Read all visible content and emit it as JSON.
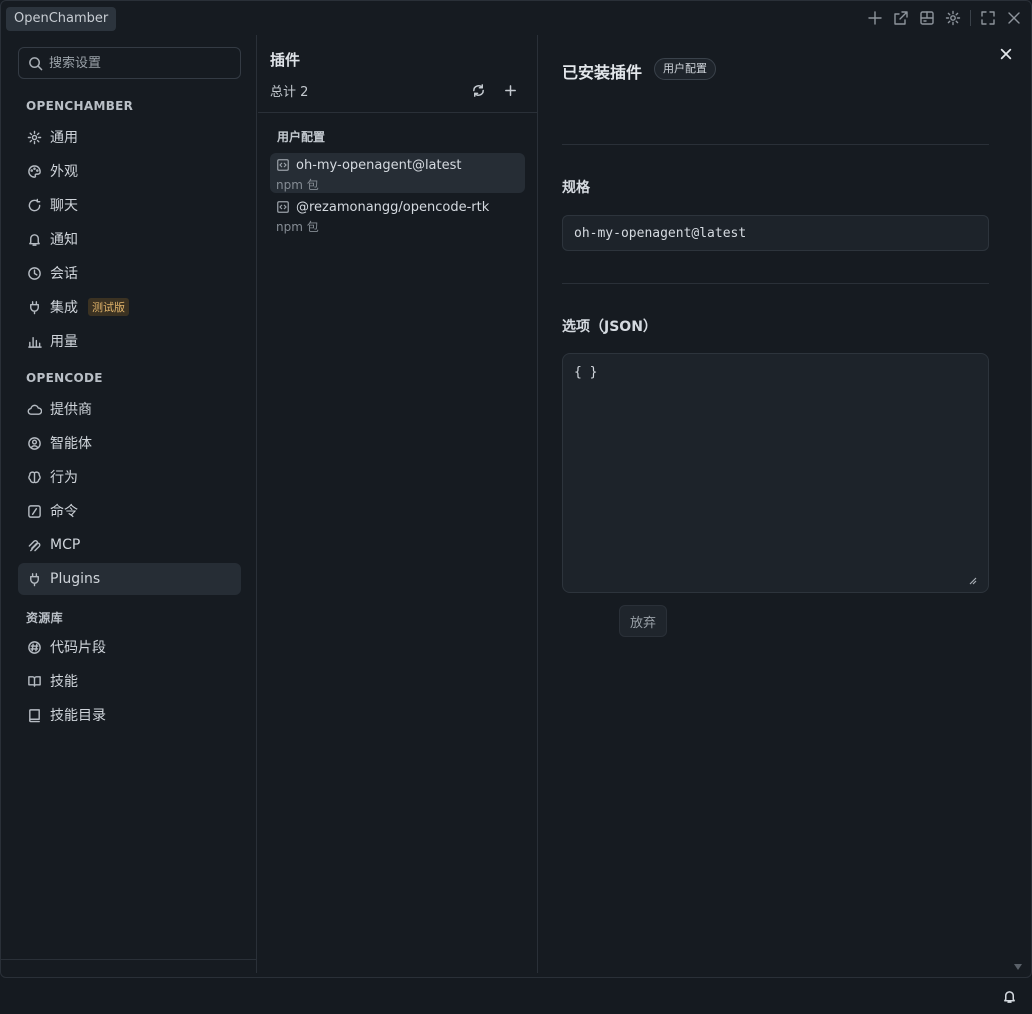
{
  "window": {
    "tab_label": "OpenChamber"
  },
  "sidebar": {
    "search_placeholder": "搜索设置",
    "sections": [
      {
        "title": "OPENCHAMBER"
      },
      {
        "title": "OPENCODE"
      },
      {
        "title": "资源库"
      }
    ],
    "items": [
      {
        "label": "通用",
        "icon": "gear-icon"
      },
      {
        "label": "外观",
        "icon": "palette-icon"
      },
      {
        "label": "聊天",
        "icon": "chat-refresh-icon"
      },
      {
        "label": "通知",
        "icon": "bell-icon"
      },
      {
        "label": "会话",
        "icon": "clock-icon"
      },
      {
        "label": "集成",
        "icon": "plug-icon",
        "badge": "测试版"
      },
      {
        "label": "用量",
        "icon": "bar-chart-icon"
      },
      {
        "label": "提供商",
        "icon": "cloud-icon"
      },
      {
        "label": "智能体",
        "icon": "robot-face-icon"
      },
      {
        "label": "行为",
        "icon": "brain-icon"
      },
      {
        "label": "命令",
        "icon": "slash-command-icon"
      },
      {
        "label": "MCP",
        "icon": "mcp-icon"
      },
      {
        "label": "Plugins",
        "icon": "plug-icon",
        "active": true
      },
      {
        "label": "代码片段",
        "icon": "hash-icon"
      },
      {
        "label": "技能",
        "icon": "book-open-icon"
      },
      {
        "label": "技能目录",
        "icon": "book-icon"
      }
    ]
  },
  "list_panel": {
    "title": "插件",
    "count_label": "总计 2",
    "group_label": "用户配置",
    "plugins": [
      {
        "name": "oh-my-openagent@latest",
        "meta": "npm 包",
        "selected": true
      },
      {
        "name": "@rezamonangg/opencode-rtk",
        "meta": "npm 包",
        "selected": false
      }
    ]
  },
  "detail": {
    "title": "已安装插件",
    "scope_badge": "用户配置",
    "spec_label": "规格",
    "spec_value": "oh-my-openagent@latest",
    "options_label": "选项（JSON）",
    "options_value": "{ }",
    "discard_label": "放弃"
  },
  "colors": {
    "background": "#161b21",
    "active_item": "#262d35",
    "beta_badge_text": "#e0b36a"
  }
}
